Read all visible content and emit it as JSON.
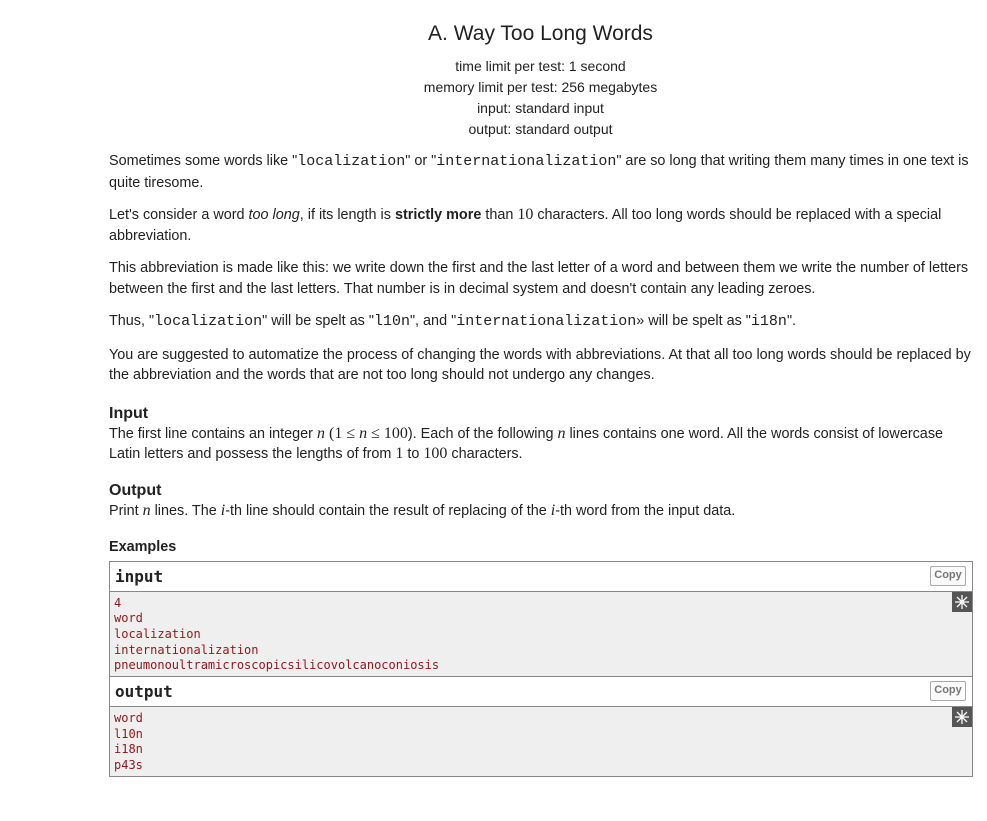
{
  "problem": {
    "title": "A. Way Too Long Words",
    "limits": [
      "time limit per test: 1 second",
      "memory limit per test: 256 megabytes",
      "input: standard input",
      "output: standard output"
    ]
  },
  "statement": {
    "p1": {
      "a": "Sometimes some words like \"",
      "w1": "localization",
      "b": "\" or \"",
      "w2": "internationalization",
      "c": "\" are so long that writing them many times in one text is quite tiresome."
    },
    "p2": {
      "a": "Let's consider a word ",
      "italic": "too long",
      "b": ", if its length is ",
      "bold": "strictly more",
      "c": " than ",
      "num": "10",
      "d": " characters. All too long words should be replaced with a special abbreviation."
    },
    "p3": "This abbreviation is made like this: we write down the first and the last letter of a word and between them we write the number of letters between the first and the last letters. That number is in decimal system and doesn't contain any leading zeroes.",
    "p4": {
      "a": "Thus, \"",
      "w1": "localization",
      "b": "\" will be spelt as \"",
      "w2": "l10n",
      "c": "\", and \"",
      "w3": "internationalization",
      "d": "» will be spelt as \"",
      "w4": "i18n",
      "e": "\"."
    },
    "p5": "You are suggested to automatize the process of changing the words with abbreviations. At that all too long words should be replaced by the abbreviation and the words that are not too long should not undergo any changes."
  },
  "input_section": {
    "title": "Input",
    "a": "The first line contains an integer ",
    "n1": "n",
    "b": " (",
    "range": "1 ≤ ",
    "n2": "n",
    "range2": " ≤ 100",
    "c": "). Each of the following ",
    "n3": "n",
    "d": " lines contains one word. All the words consist of lowercase Latin letters and possess the lengths of from ",
    "lo": "1",
    "e": " to ",
    "hi": "100",
    "f": " characters."
  },
  "output_section": {
    "title": "Output",
    "a": "Print ",
    "n": "n",
    "b": " lines. The ",
    "i1": "i",
    "c": "-th line should contain the result of replacing of the ",
    "i2": "i",
    "d": "-th word from the input data."
  },
  "examples": {
    "title": "Examples",
    "input_label": "input",
    "output_label": "output",
    "copy_label": "Copy",
    "input_lines": [
      "4",
      "word",
      "localization",
      "internationalization",
      "pneumonoultramicroscopicsilicovolcanoconiosis"
    ],
    "output_lines": [
      "word",
      "l10n",
      "i18n",
      "p43s"
    ]
  }
}
